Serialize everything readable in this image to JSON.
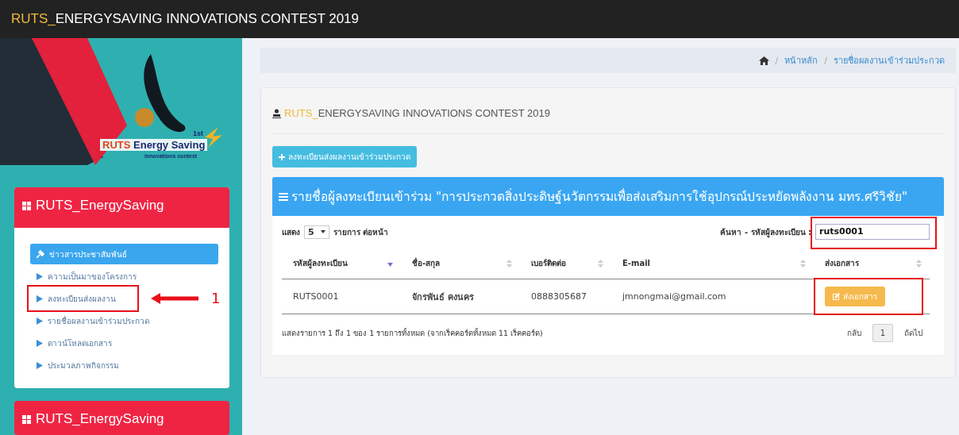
{
  "topbar": {
    "title_accent": "RUTS_",
    "title_rest": "ENERGYSAVING INNOVATIONS CONTEST 2019"
  },
  "logo": {
    "brand_accent": "RUTS",
    "brand_rest": "Energy Saving",
    "badge": "1st",
    "tagline": "innovations contest"
  },
  "sidebar": {
    "panels": [
      {
        "title": "RUTS_EnergySaving",
        "items": [
          {
            "label": "ข่าวสารประชาสัมพันธ์",
            "kind": "pin",
            "selected": true,
            "highlighted": false
          },
          {
            "label": "ความเป็นมาของโครงการ",
            "kind": "arrow",
            "selected": false,
            "highlighted": false
          },
          {
            "label": "ลงทะเบียนส่งผลงาน",
            "kind": "arrow",
            "selected": false,
            "highlighted": true,
            "callout": "1"
          },
          {
            "label": "รายชื่อผลงานเข้าร่วมประกวด",
            "kind": "arrow",
            "selected": false,
            "highlighted": false
          },
          {
            "label": "ดาวน์โหลดเอกสาร",
            "kind": "arrow",
            "selected": false,
            "highlighted": false
          },
          {
            "label": "ประมวลภาพกิจกรรม",
            "kind": "arrow",
            "selected": false,
            "highlighted": false
          }
        ]
      },
      {
        "title": "RUTS_EnergySaving"
      }
    ]
  },
  "breadcrumb": [
    {
      "separator": "/",
      "label": "หน้าหลัก"
    },
    {
      "separator": "/",
      "label": "รายชื่อผลงานเข้าร่วมประกวด"
    }
  ],
  "card": {
    "title_accent": "RUTS_",
    "title_rest": "ENERGYSAVING INNOVATIONS CONTEST 2019",
    "add_button": "ลงทะเบียนส่งผลงานเข้าร่วมประกวด",
    "panel": {
      "title": "รายชื่อผู้ลงทะเบียนเข้าร่วม \"การประกวดสิ่งประดิษฐ์นวัตกรรมเพื่อส่งเสริมการใช้อุปกรณ์ประหยัดพลังงาน มทร.ศรีวิชัย\"",
      "show_label": "แสดง",
      "page_size": "5",
      "per_page_label": "รายการ ต่อหน้า",
      "search": {
        "label": "ค้นหา - รหัสผู้ลงทะเบียน :",
        "value": "ruts0001",
        "highlighted": true
      },
      "columns": [
        {
          "label": "รหัสผู้ลงทะเบียน",
          "sorted": true
        },
        {
          "label": "ชื่อ-สกุล",
          "sorted": false
        },
        {
          "label": "เบอร์ติดต่อ",
          "sorted": false
        },
        {
          "label": "E-mail",
          "sorted": false
        },
        {
          "label": "ส่งเอกสาร",
          "sorted": false
        }
      ],
      "rows": [
        {
          "id": "RUTS0001",
          "name": "จักรพันธ์ คงนคร",
          "phone": "0888305687",
          "email": "jmnongmai@gmail.com",
          "action": "ส่งเอกสาร",
          "highlighted": true
        }
      ],
      "summary": "แสดงรายการ 1 ถึง 1 ของ 1 รายการทั้งหมด (จากเร็คคอร์ดทั้งหมด 11 เร็คคอร์ด)",
      "pagination": [
        {
          "label": "กลับ",
          "selected": false
        },
        {
          "label": "1",
          "selected": true
        },
        {
          "label": "ถัดไป",
          "selected": false
        }
      ]
    }
  }
}
